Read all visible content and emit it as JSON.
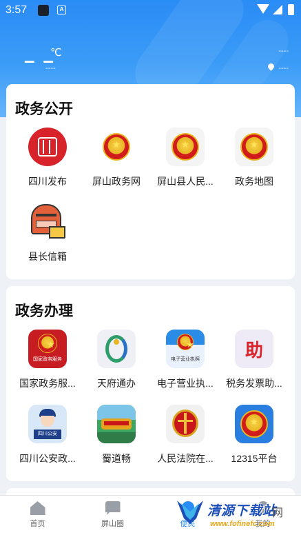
{
  "status_bar": {
    "time": "3:57",
    "notif_letter": "A"
  },
  "weather": {
    "temperature": "– –",
    "unit": "℃",
    "description": "----",
    "right_top": "----",
    "location": "----"
  },
  "sections": [
    {
      "title": "政务公开",
      "items": [
        {
          "label": "四川发布",
          "icon": "sichuan-fabu-icon"
        },
        {
          "label": "屏山政务网",
          "icon": "national-emblem-icon"
        },
        {
          "label": "屏山县人民...",
          "icon": "national-emblem-icon"
        },
        {
          "label": "政务地图",
          "icon": "national-emblem-icon"
        },
        {
          "label": "县长信箱",
          "icon": "mailbox-icon"
        }
      ]
    },
    {
      "title": "政务办理",
      "items": [
        {
          "label": "国家政务服...",
          "icon": "national-gov-service-icon",
          "icon_text": "国家政务服务"
        },
        {
          "label": "天府通办",
          "icon": "tianfu-tongban-icon"
        },
        {
          "label": "电子营业执...",
          "icon": "e-business-license-icon",
          "icon_text": "电子营业执照"
        },
        {
          "label": "税务发票助...",
          "icon": "tax-invoice-icon",
          "icon_text": "助"
        },
        {
          "label": "四川公安政...",
          "icon": "sichuan-police-icon",
          "icon_text": "四川公安"
        },
        {
          "label": "蜀道畅",
          "icon": "shudao-chang-icon"
        },
        {
          "label": "人民法院在...",
          "icon": "court-emblem-icon"
        },
        {
          "label": "12315平台",
          "icon": "12315-platform-icon"
        }
      ]
    }
  ],
  "tabbar": {
    "tabs": [
      {
        "label": "首页",
        "icon": "home-icon"
      },
      {
        "label": "屏山圈",
        "icon": "chat-icon"
      },
      {
        "label": "便民",
        "icon": "person-icon",
        "active": true
      },
      {
        "label": "我的",
        "icon": "profile-icon"
      }
    ]
  },
  "watermark": {
    "brand": "清源下载站",
    "suffix": "网",
    "url": "www.fofinefc.com"
  },
  "colors": {
    "primary": "#2a8cf5",
    "hero": "#3b9cf7",
    "background": "#eef1f6"
  }
}
